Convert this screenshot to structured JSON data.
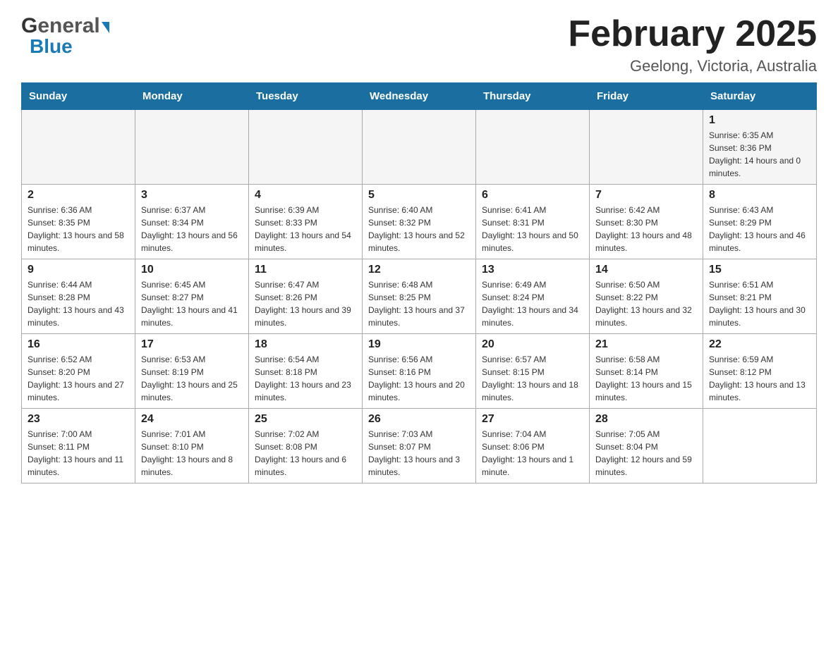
{
  "logo": {
    "part1": "General",
    "part2": "Blue"
  },
  "title": "February 2025",
  "subtitle": "Geelong, Victoria, Australia",
  "weekdays": [
    "Sunday",
    "Monday",
    "Tuesday",
    "Wednesday",
    "Thursday",
    "Friday",
    "Saturday"
  ],
  "weeks": [
    [
      {
        "day": "",
        "sunrise": "",
        "sunset": "",
        "daylight": ""
      },
      {
        "day": "",
        "sunrise": "",
        "sunset": "",
        "daylight": ""
      },
      {
        "day": "",
        "sunrise": "",
        "sunset": "",
        "daylight": ""
      },
      {
        "day": "",
        "sunrise": "",
        "sunset": "",
        "daylight": ""
      },
      {
        "day": "",
        "sunrise": "",
        "sunset": "",
        "daylight": ""
      },
      {
        "day": "",
        "sunrise": "",
        "sunset": "",
        "daylight": ""
      },
      {
        "day": "1",
        "sunrise": "Sunrise: 6:35 AM",
        "sunset": "Sunset: 8:36 PM",
        "daylight": "Daylight: 14 hours and 0 minutes."
      }
    ],
    [
      {
        "day": "2",
        "sunrise": "Sunrise: 6:36 AM",
        "sunset": "Sunset: 8:35 PM",
        "daylight": "Daylight: 13 hours and 58 minutes."
      },
      {
        "day": "3",
        "sunrise": "Sunrise: 6:37 AM",
        "sunset": "Sunset: 8:34 PM",
        "daylight": "Daylight: 13 hours and 56 minutes."
      },
      {
        "day": "4",
        "sunrise": "Sunrise: 6:39 AM",
        "sunset": "Sunset: 8:33 PM",
        "daylight": "Daylight: 13 hours and 54 minutes."
      },
      {
        "day": "5",
        "sunrise": "Sunrise: 6:40 AM",
        "sunset": "Sunset: 8:32 PM",
        "daylight": "Daylight: 13 hours and 52 minutes."
      },
      {
        "day": "6",
        "sunrise": "Sunrise: 6:41 AM",
        "sunset": "Sunset: 8:31 PM",
        "daylight": "Daylight: 13 hours and 50 minutes."
      },
      {
        "day": "7",
        "sunrise": "Sunrise: 6:42 AM",
        "sunset": "Sunset: 8:30 PM",
        "daylight": "Daylight: 13 hours and 48 minutes."
      },
      {
        "day": "8",
        "sunrise": "Sunrise: 6:43 AM",
        "sunset": "Sunset: 8:29 PM",
        "daylight": "Daylight: 13 hours and 46 minutes."
      }
    ],
    [
      {
        "day": "9",
        "sunrise": "Sunrise: 6:44 AM",
        "sunset": "Sunset: 8:28 PM",
        "daylight": "Daylight: 13 hours and 43 minutes."
      },
      {
        "day": "10",
        "sunrise": "Sunrise: 6:45 AM",
        "sunset": "Sunset: 8:27 PM",
        "daylight": "Daylight: 13 hours and 41 minutes."
      },
      {
        "day": "11",
        "sunrise": "Sunrise: 6:47 AM",
        "sunset": "Sunset: 8:26 PM",
        "daylight": "Daylight: 13 hours and 39 minutes."
      },
      {
        "day": "12",
        "sunrise": "Sunrise: 6:48 AM",
        "sunset": "Sunset: 8:25 PM",
        "daylight": "Daylight: 13 hours and 37 minutes."
      },
      {
        "day": "13",
        "sunrise": "Sunrise: 6:49 AM",
        "sunset": "Sunset: 8:24 PM",
        "daylight": "Daylight: 13 hours and 34 minutes."
      },
      {
        "day": "14",
        "sunrise": "Sunrise: 6:50 AM",
        "sunset": "Sunset: 8:22 PM",
        "daylight": "Daylight: 13 hours and 32 minutes."
      },
      {
        "day": "15",
        "sunrise": "Sunrise: 6:51 AM",
        "sunset": "Sunset: 8:21 PM",
        "daylight": "Daylight: 13 hours and 30 minutes."
      }
    ],
    [
      {
        "day": "16",
        "sunrise": "Sunrise: 6:52 AM",
        "sunset": "Sunset: 8:20 PM",
        "daylight": "Daylight: 13 hours and 27 minutes."
      },
      {
        "day": "17",
        "sunrise": "Sunrise: 6:53 AM",
        "sunset": "Sunset: 8:19 PM",
        "daylight": "Daylight: 13 hours and 25 minutes."
      },
      {
        "day": "18",
        "sunrise": "Sunrise: 6:54 AM",
        "sunset": "Sunset: 8:18 PM",
        "daylight": "Daylight: 13 hours and 23 minutes."
      },
      {
        "day": "19",
        "sunrise": "Sunrise: 6:56 AM",
        "sunset": "Sunset: 8:16 PM",
        "daylight": "Daylight: 13 hours and 20 minutes."
      },
      {
        "day": "20",
        "sunrise": "Sunrise: 6:57 AM",
        "sunset": "Sunset: 8:15 PM",
        "daylight": "Daylight: 13 hours and 18 minutes."
      },
      {
        "day": "21",
        "sunrise": "Sunrise: 6:58 AM",
        "sunset": "Sunset: 8:14 PM",
        "daylight": "Daylight: 13 hours and 15 minutes."
      },
      {
        "day": "22",
        "sunrise": "Sunrise: 6:59 AM",
        "sunset": "Sunset: 8:12 PM",
        "daylight": "Daylight: 13 hours and 13 minutes."
      }
    ],
    [
      {
        "day": "23",
        "sunrise": "Sunrise: 7:00 AM",
        "sunset": "Sunset: 8:11 PM",
        "daylight": "Daylight: 13 hours and 11 minutes."
      },
      {
        "day": "24",
        "sunrise": "Sunrise: 7:01 AM",
        "sunset": "Sunset: 8:10 PM",
        "daylight": "Daylight: 13 hours and 8 minutes."
      },
      {
        "day": "25",
        "sunrise": "Sunrise: 7:02 AM",
        "sunset": "Sunset: 8:08 PM",
        "daylight": "Daylight: 13 hours and 6 minutes."
      },
      {
        "day": "26",
        "sunrise": "Sunrise: 7:03 AM",
        "sunset": "Sunset: 8:07 PM",
        "daylight": "Daylight: 13 hours and 3 minutes."
      },
      {
        "day": "27",
        "sunrise": "Sunrise: 7:04 AM",
        "sunset": "Sunset: 8:06 PM",
        "daylight": "Daylight: 13 hours and 1 minute."
      },
      {
        "day": "28",
        "sunrise": "Sunrise: 7:05 AM",
        "sunset": "Sunset: 8:04 PM",
        "daylight": "Daylight: 12 hours and 59 minutes."
      },
      {
        "day": "",
        "sunrise": "",
        "sunset": "",
        "daylight": ""
      }
    ]
  ]
}
